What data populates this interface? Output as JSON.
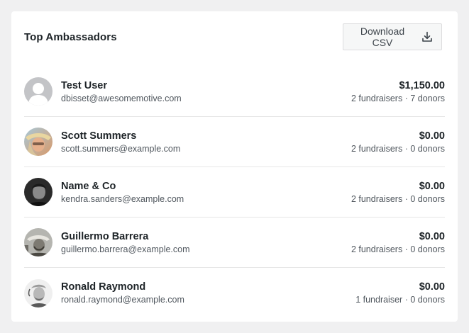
{
  "widget": {
    "title": "Top Ambassadors",
    "download_label": "Download CSV",
    "download_icon": "download-icon"
  },
  "ambassadors": [
    {
      "name": "Test User",
      "email": "dbisset@awesomemotive.com",
      "amount": "$1,150.00",
      "fundraisers": "2 fundraisers",
      "separator": "·",
      "donors": "7 donors",
      "avatar": "default-avatar"
    },
    {
      "name": "Scott Summers",
      "email": "scott.summers@example.com",
      "amount": "$0.00",
      "fundraisers": "2 fundraisers",
      "separator": "·",
      "donors": "0 donors",
      "avatar": "photo-avatar"
    },
    {
      "name": "Name & Co",
      "email": "kendra.sanders@example.com",
      "amount": "$0.00",
      "fundraisers": "2 fundraisers",
      "separator": "·",
      "donors": "0 donors",
      "avatar": "photo-avatar"
    },
    {
      "name": "Guillermo Barrera",
      "email": "guillermo.barrera@example.com",
      "amount": "$0.00",
      "fundraisers": "2 fundraisers",
      "separator": "·",
      "donors": "0 donors",
      "avatar": "photo-avatar"
    },
    {
      "name": "Ronald Raymond",
      "email": "ronald.raymond@example.com",
      "amount": "$0.00",
      "fundraisers": "1 fundraiser",
      "separator": "·",
      "donors": "0 donors",
      "avatar": "photo-avatar"
    }
  ],
  "colors": {
    "background": "#f0f0f1",
    "card": "#ffffff",
    "text": "#1d2327",
    "muted_text": "#50575e",
    "divider": "#e6e6e6",
    "button_bg": "#f6f7f7",
    "button_border": "#dcdcde"
  }
}
